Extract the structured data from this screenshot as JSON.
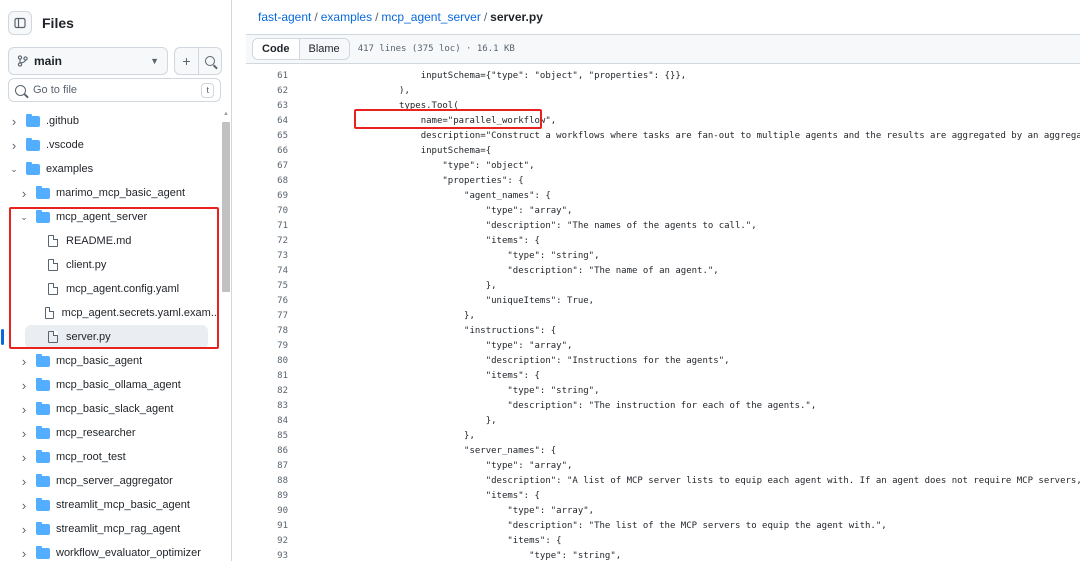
{
  "sidebar": {
    "title": "Files",
    "branch": "main",
    "goto_placeholder": "Go to file",
    "goto_shortcut": "t",
    "add_label": "+",
    "tree": [
      {
        "label": ".github",
        "type": "folder",
        "depth": 0,
        "expanded": false
      },
      {
        "label": ".vscode",
        "type": "folder",
        "depth": 0,
        "expanded": false
      },
      {
        "label": "examples",
        "type": "folder",
        "depth": 0,
        "expanded": true
      },
      {
        "label": "marimo_mcp_basic_agent",
        "type": "folder",
        "depth": 1,
        "expanded": false
      },
      {
        "label": "mcp_agent_server",
        "type": "folder",
        "depth": 1,
        "expanded": true
      },
      {
        "label": "README.md",
        "type": "file",
        "depth": 2
      },
      {
        "label": "client.py",
        "type": "file",
        "depth": 2
      },
      {
        "label": "mcp_agent.config.yaml",
        "type": "file",
        "depth": 2
      },
      {
        "label": "mcp_agent.secrets.yaml.exam...",
        "type": "file",
        "depth": 2
      },
      {
        "label": "server.py",
        "type": "file",
        "depth": 2,
        "selected": true
      },
      {
        "label": "mcp_basic_agent",
        "type": "folder",
        "depth": 1,
        "expanded": false
      },
      {
        "label": "mcp_basic_ollama_agent",
        "type": "folder",
        "depth": 1,
        "expanded": false
      },
      {
        "label": "mcp_basic_slack_agent",
        "type": "folder",
        "depth": 1,
        "expanded": false
      },
      {
        "label": "mcp_researcher",
        "type": "folder",
        "depth": 1,
        "expanded": false
      },
      {
        "label": "mcp_root_test",
        "type": "folder",
        "depth": 1,
        "expanded": false
      },
      {
        "label": "mcp_server_aggregator",
        "type": "folder",
        "depth": 1,
        "expanded": false
      },
      {
        "label": "streamlit_mcp_basic_agent",
        "type": "folder",
        "depth": 1,
        "expanded": false
      },
      {
        "label": "streamlit_mcp_rag_agent",
        "type": "folder",
        "depth": 1,
        "expanded": false
      },
      {
        "label": "workflow_evaluator_optimizer",
        "type": "folder",
        "depth": 1,
        "expanded": false
      }
    ]
  },
  "breadcrumb": {
    "repo": "fast-agent",
    "dir1": "examples",
    "dir2": "mcp_agent_server",
    "file": "server.py",
    "sep": "/"
  },
  "toolbar": {
    "code_tab": "Code",
    "blame_tab": "Blame",
    "file_info": "417 lines (375 loc) · 16.1 KB"
  },
  "code": [
    {
      "n": "61",
      "t": "                inputSchema={\"type\": \"object\", \"properties\": {}},"
    },
    {
      "n": "62",
      "t": "            ),"
    },
    {
      "n": "63",
      "t": "            types.Tool("
    },
    {
      "n": "64",
      "t": "                name=\"parallel_workflow\","
    },
    {
      "n": "65",
      "t": "                description=\"Construct a workflows where tasks are fan-out to multiple agents and the results are aggregated by an aggregator agent.\","
    },
    {
      "n": "66",
      "t": "                inputSchema={"
    },
    {
      "n": "67",
      "t": "                    \"type\": \"object\","
    },
    {
      "n": "68",
      "t": "                    \"properties\": {"
    },
    {
      "n": "69",
      "t": "                        \"agent_names\": {"
    },
    {
      "n": "70",
      "t": "                            \"type\": \"array\","
    },
    {
      "n": "71",
      "t": "                            \"description\": \"The names of the agents to call.\","
    },
    {
      "n": "72",
      "t": "                            \"items\": {"
    },
    {
      "n": "73",
      "t": "                                \"type\": \"string\","
    },
    {
      "n": "74",
      "t": "                                \"description\": \"The name of an agent.\","
    },
    {
      "n": "75",
      "t": "                            },"
    },
    {
      "n": "76",
      "t": "                            \"uniqueItems\": True,"
    },
    {
      "n": "77",
      "t": "                        },"
    },
    {
      "n": "78",
      "t": "                        \"instructions\": {"
    },
    {
      "n": "79",
      "t": "                            \"type\": \"array\","
    },
    {
      "n": "80",
      "t": "                            \"description\": \"Instructions for the agents\","
    },
    {
      "n": "81",
      "t": "                            \"items\": {"
    },
    {
      "n": "82",
      "t": "                                \"type\": \"string\","
    },
    {
      "n": "83",
      "t": "                                \"description\": \"The instruction for each of the agents.\","
    },
    {
      "n": "84",
      "t": "                            },"
    },
    {
      "n": "85",
      "t": "                        },"
    },
    {
      "n": "86",
      "t": "                        \"server_names\": {"
    },
    {
      "n": "87",
      "t": "                            \"type\": \"array\","
    },
    {
      "n": "88",
      "t": "                            \"description\": \"A list of MCP server lists to equip each agent with. If an agent does not require MCP servers, give it an empty lis"
    },
    {
      "n": "89",
      "t": "                            \"items\": {"
    },
    {
      "n": "90",
      "t": "                                \"type\": \"array\","
    },
    {
      "n": "91",
      "t": "                                \"description\": \"The list of the MCP servers to equip the agent with.\","
    },
    {
      "n": "92",
      "t": "                                \"items\": {"
    },
    {
      "n": "93",
      "t": "                                    \"type\": \"string\","
    }
  ],
  "colors": {
    "link": "#0969da",
    "folder": "#54aeff",
    "highlight_box": "#e8231f",
    "selected_bg": "#eaeef2"
  }
}
